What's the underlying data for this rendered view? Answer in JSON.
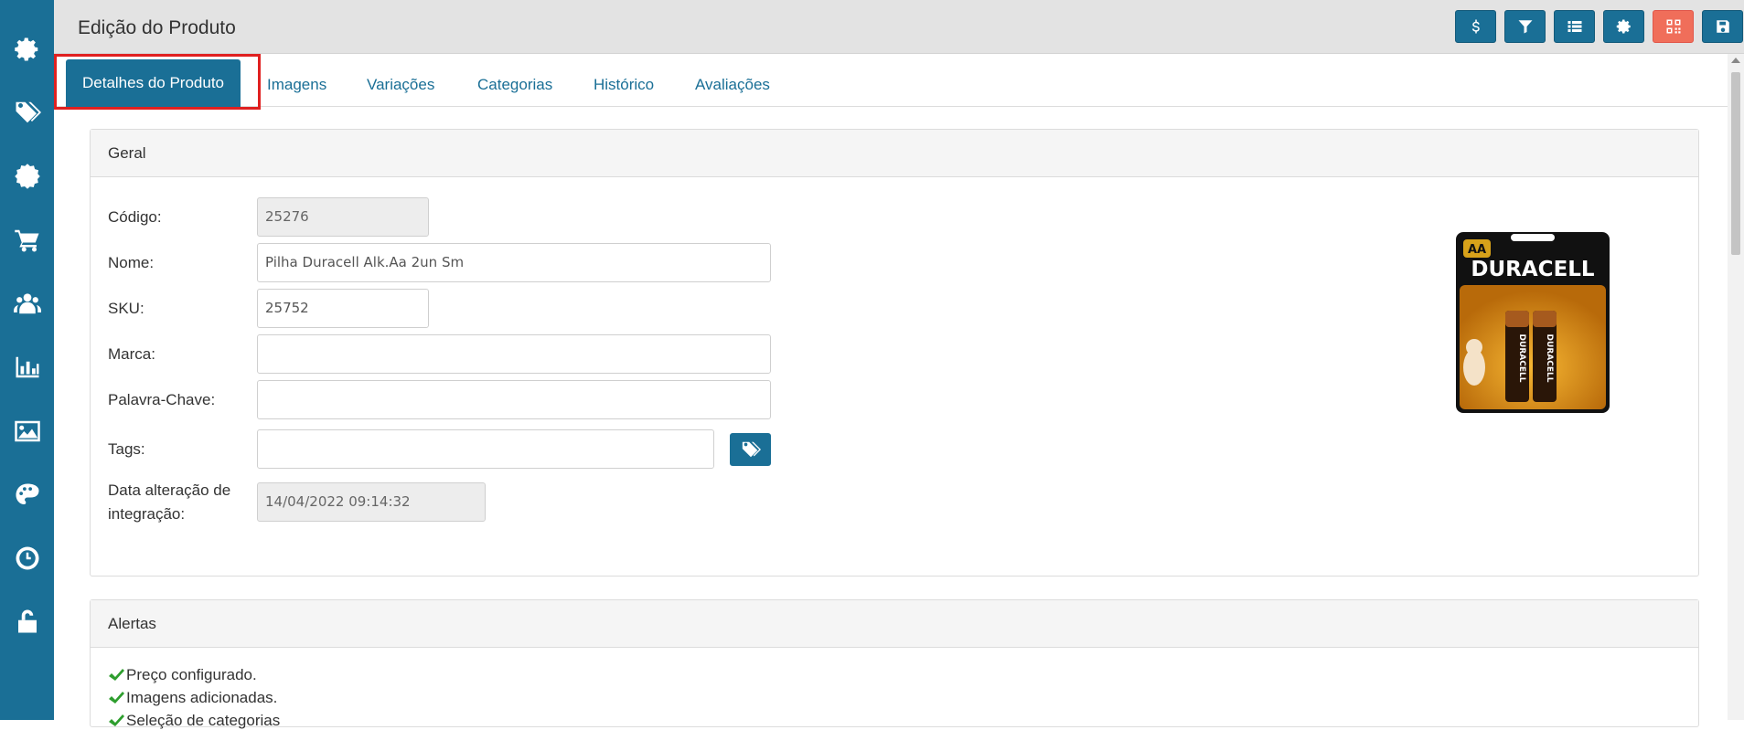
{
  "header": {
    "title": "Edição do Produto"
  },
  "toolbar": {
    "buttons": [
      "dollar-icon",
      "filter-icon",
      "list-icon",
      "gear-icon",
      "qrcode-icon",
      "save-icon"
    ]
  },
  "sidebar": {
    "items": [
      "gear-icon",
      "tags-icon",
      "badge-icon",
      "cart-icon",
      "users-icon",
      "chart-icon",
      "image-icon",
      "palette-icon",
      "clock-icon",
      "unlock-icon"
    ]
  },
  "tabs": [
    "Detalhes do Produto",
    "Imagens",
    "Variações",
    "Categorias",
    "Histórico",
    "Avaliações"
  ],
  "geral": {
    "title": "Geral",
    "codigo_label": "Código:",
    "codigo_value": "25276",
    "nome_label": "Nome:",
    "nome_value": "Pilha Duracell Alk.Aa 2un Sm",
    "sku_label": "SKU:",
    "sku_value": "25752",
    "marca_label": "Marca:",
    "marca_value": "",
    "palavra_label": "Palavra-Chave:",
    "palavra_value": "",
    "tags_label": "Tags:",
    "tags_value": "",
    "data_label_1": "Data alteração de",
    "data_label_2": "integração:",
    "data_value": "14/04/2022 09:14:32"
  },
  "product_image": {
    "brand": "DURACELL",
    "size": "AA",
    "label": "DURACELL"
  },
  "alertas": {
    "title": "Alertas",
    "items": [
      "Preço configurado.",
      "Imagens adicionadas.",
      "Seleção de categorias"
    ]
  },
  "colors": {
    "primary": "#1a6f96",
    "danger": "#f06e5a",
    "highlight": "#e02020",
    "success": "#2e9e2e"
  }
}
